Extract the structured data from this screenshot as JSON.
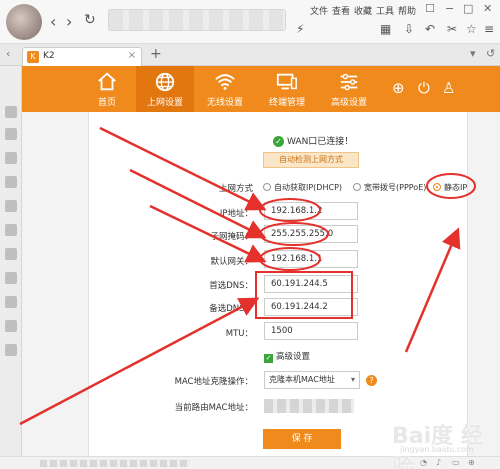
{
  "browser": {
    "menu": [
      "文件",
      "查看",
      "收藏",
      "工具",
      "帮助"
    ],
    "tab_title": "K2",
    "tab_favicon": "K"
  },
  "router": {
    "nav": [
      {
        "label": "首页",
        "icon": "home-icon"
      },
      {
        "label": "上网设置",
        "icon": "globe-icon",
        "active": true
      },
      {
        "label": "无线设置",
        "icon": "wifi-icon"
      },
      {
        "label": "终端管理",
        "icon": "devices-icon"
      },
      {
        "label": "高级设置",
        "icon": "sliders-icon"
      }
    ],
    "header_icons": [
      "plus-icon",
      "power-icon",
      "user-icon"
    ],
    "accent": "#f08a1c"
  },
  "form": {
    "status": "WAN口已连接！",
    "detect_button": "自动检测上网方式",
    "mode_label": "上网方式",
    "modes": [
      "自动获取IP(DHCP)",
      "宽带拨号(PPPoE)",
      "静态IP"
    ],
    "selected_mode": "静态IP",
    "ip_label": "IP地址：",
    "ip_value": "192.168.1.2",
    "mask_label": "子网掩码：",
    "mask_value": "255.255.255.0",
    "gateway_label": "默认网关：",
    "gateway_value": "192.168.1.1",
    "dns1_label": "首选DNS：",
    "dns1_value": "60.191.244.5",
    "dns2_label": "备选DNS：",
    "dns2_value": "60.191.244.2",
    "mtu_label": "MTU：",
    "mtu_value": "1500",
    "advanced_label": "高级设置",
    "advanced_checked": true,
    "mac_clone_label": "MAC地址克隆操作：",
    "mac_clone_value": "克隆本机MAC地址",
    "current_mac_label": "当前路由MAC地址：",
    "save_button": "保 存",
    "help_glyph": "?"
  },
  "watermark": {
    "text": "Bai度 经验",
    "sub": "jingyan.baidu.com"
  },
  "colors": {
    "annotation": "#e4312b",
    "ok_green": "#3aa63a"
  }
}
